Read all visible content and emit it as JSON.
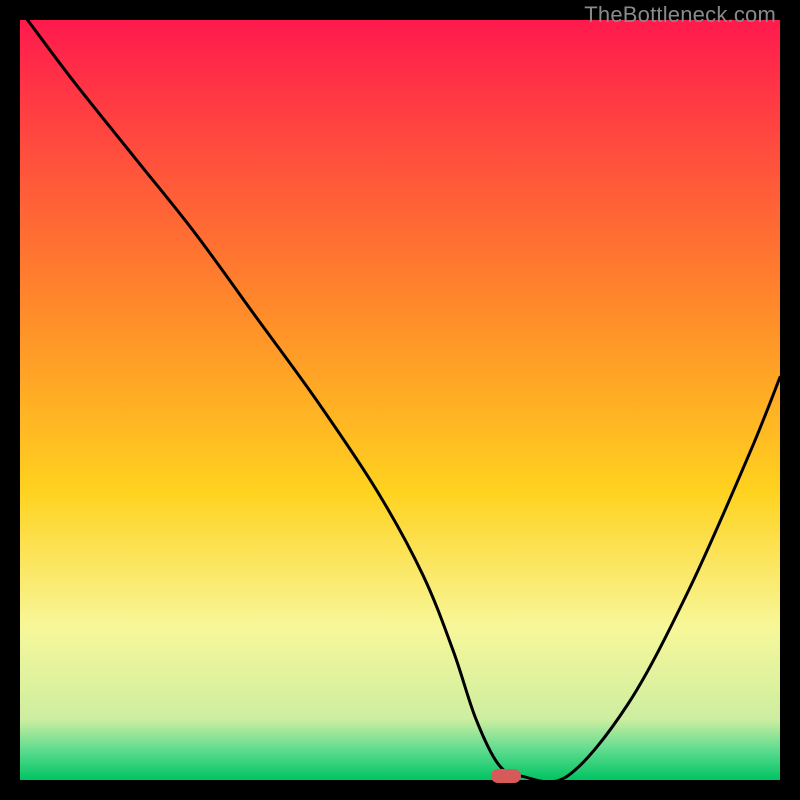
{
  "watermark": "TheBottleneck.com",
  "colors": {
    "gradient_top": "#ff1a4d",
    "gradient_mid1": "#ff6a2a",
    "gradient_mid2": "#ffd21f",
    "gradient_mid3": "#f7f79a",
    "gradient_bottom_band": "#29d67a",
    "gradient_bottom": "#00c463",
    "marker": "#d65a5a",
    "curve": "#000000"
  },
  "chart_data": {
    "type": "line",
    "title": "",
    "xlabel": "",
    "ylabel": "",
    "xlim": [
      0,
      100
    ],
    "ylim": [
      0,
      100
    ],
    "series": [
      {
        "name": "bottleneck-curve",
        "x": [
          1,
          7,
          15,
          23,
          31,
          39,
          47,
          53,
          57,
          60,
          63,
          66,
          72,
          80,
          88,
          96,
          100
        ],
        "y": [
          100,
          92,
          82,
          72,
          61,
          50,
          38,
          27,
          17,
          8,
          2,
          0.5,
          0.5,
          10,
          25,
          43,
          53
        ]
      }
    ],
    "marker": {
      "x": 64,
      "y": 0.5
    },
    "gradient_stops": [
      {
        "pos": 0,
        "color": "#ff1a4d"
      },
      {
        "pos": 38,
        "color": "#ff8a2a"
      },
      {
        "pos": 62,
        "color": "#ffd21f"
      },
      {
        "pos": 80,
        "color": "#f7f79a"
      },
      {
        "pos": 92,
        "color": "#cdeea0"
      },
      {
        "pos": 96,
        "color": "#5fdc8f"
      },
      {
        "pos": 100,
        "color": "#00c463"
      }
    ]
  }
}
